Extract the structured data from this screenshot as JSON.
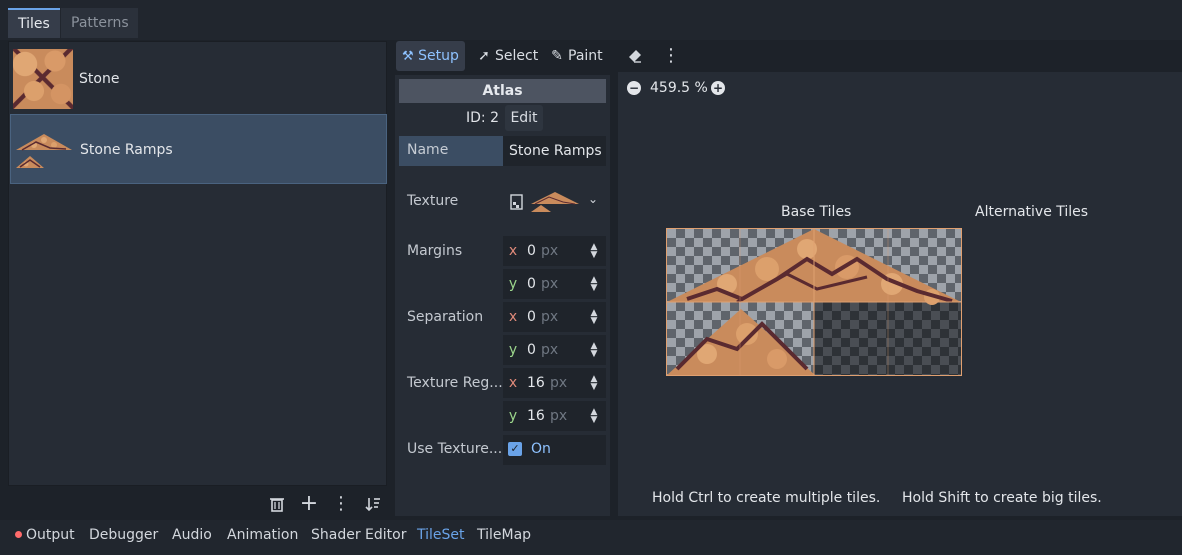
{
  "top_tabs": {
    "tiles": "Tiles",
    "patterns": "Patterns"
  },
  "sources": [
    {
      "label": "Stone",
      "icon": "stone-texture-thumbnail"
    },
    {
      "label": "Stone Ramps",
      "icon": "stone-ramps-texture-thumbnail",
      "selected": true
    }
  ],
  "list_toolbar": {
    "icons": [
      "trash-icon",
      "plus-icon",
      "kebab-menu-icon",
      "sort-icon"
    ]
  },
  "tools": {
    "setup": "Setup",
    "select": "Select",
    "paint": "Paint",
    "icons": [
      "setup-tools-icon",
      "cursor-icon",
      "brush-icon",
      "eraser-icon",
      "kebab-menu-icon"
    ]
  },
  "inspector": {
    "header": "Atlas",
    "id_label": "ID: 2",
    "edit": "Edit",
    "name_label": "Name",
    "name_value": "Stone Ramps",
    "texture_label": "Texture",
    "margins_label": "Margins",
    "margins": {
      "x": "0",
      "y": "0"
    },
    "separation_label": "Separation",
    "separation": {
      "x": "0",
      "y": "0"
    },
    "texture_region_label": "Texture Reg...",
    "texture_region": {
      "x": "16",
      "y": "16"
    },
    "use_texture_label": "Use Texture...",
    "use_texture_value": "On",
    "unit": "px",
    "axis_x": "x",
    "axis_y": "y"
  },
  "atlas_view": {
    "zoom": "459.5 %",
    "base_tiles": "Base Tiles",
    "alternative_tiles": "Alternative Tiles",
    "hint_ctrl": "Hold Ctrl to create multiple tiles.",
    "hint_shift": "Hold Shift to create big tiles."
  },
  "bottom_tabs": [
    "Output",
    "Debugger",
    "Audio",
    "Animation",
    "Shader Editor",
    "TileSet",
    "TileMap"
  ],
  "colors": {
    "accent": "#6aa3e8",
    "selected_row": "#3b4d63",
    "error_dot": "#ff6b6b"
  }
}
